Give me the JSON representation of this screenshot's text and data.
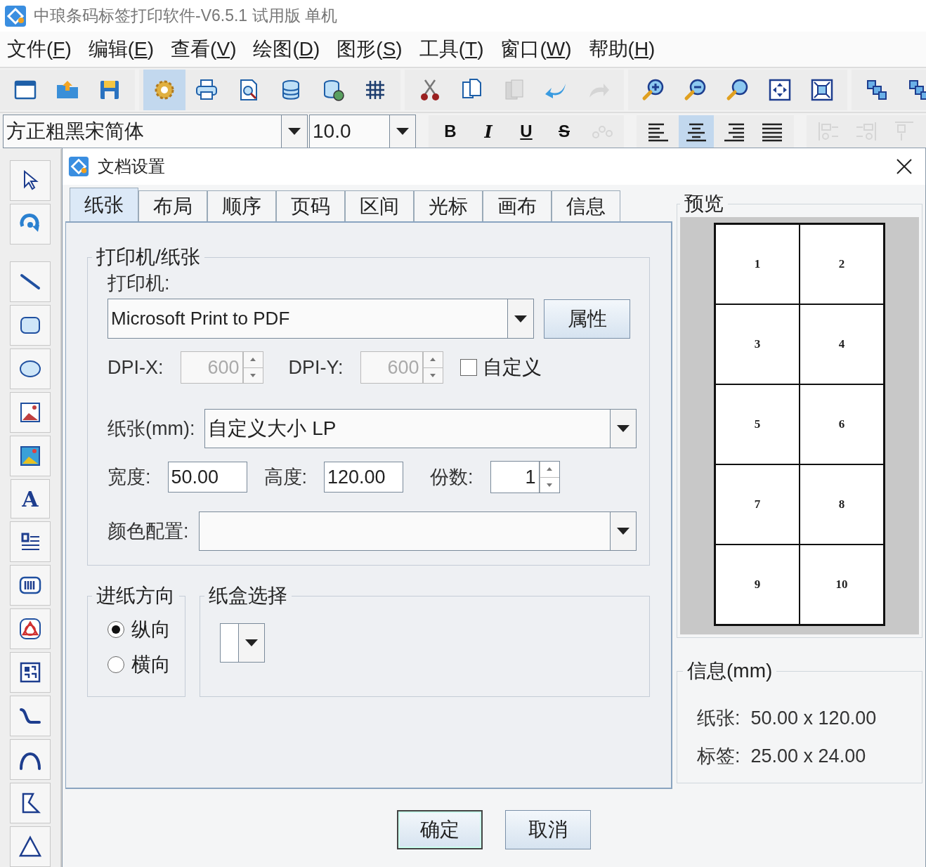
{
  "window": {
    "title": "中琅条码标签打印软件-V6.5.1 试用版 单机"
  },
  "menu": [
    {
      "label": "文件(",
      "key": "F",
      "end": ")"
    },
    {
      "label": "编辑(",
      "key": "E",
      "end": ")"
    },
    {
      "label": "查看(",
      "key": "V",
      "end": ")"
    },
    {
      "label": "绘图(",
      "key": "D",
      "end": ")"
    },
    {
      "label": "图形(",
      "key": "S",
      "end": ")"
    },
    {
      "label": "工具(",
      "key": "T",
      "end": ")"
    },
    {
      "label": "窗口(",
      "key": "W",
      "end": ")"
    },
    {
      "label": "帮助(",
      "key": "H",
      "end": ")"
    }
  ],
  "toolbar": [
    [
      {
        "kind": "window",
        "selected": false,
        "disabled": false
      },
      {
        "kind": "open",
        "selected": false,
        "disabled": false
      },
      {
        "kind": "save",
        "selected": false,
        "disabled": false
      }
    ],
    [
      {
        "kind": "gear",
        "selected": true,
        "disabled": false
      },
      {
        "kind": "print",
        "selected": false,
        "disabled": false
      },
      {
        "kind": "preview",
        "selected": false,
        "disabled": false
      },
      {
        "kind": "database",
        "selected": false,
        "disabled": false
      },
      {
        "kind": "dbsync",
        "selected": false,
        "disabled": false
      },
      {
        "kind": "grid",
        "selected": false,
        "disabled": false
      }
    ],
    [
      {
        "kind": "cut",
        "selected": false,
        "disabled": false
      },
      {
        "kind": "copy",
        "selected": false,
        "disabled": false
      },
      {
        "kind": "paste",
        "selected": false,
        "disabled": true
      },
      {
        "kind": "undo",
        "selected": false,
        "disabled": false
      },
      {
        "kind": "redo",
        "selected": false,
        "disabled": true
      }
    ],
    [
      {
        "kind": "zoomin",
        "selected": false,
        "disabled": false
      },
      {
        "kind": "zoomout",
        "selected": false,
        "disabled": false
      },
      {
        "kind": "zoom",
        "selected": false,
        "disabled": false
      },
      {
        "kind": "fit",
        "selected": false,
        "disabled": false
      },
      {
        "kind": "fitpage",
        "selected": false,
        "disabled": false
      }
    ],
    [
      {
        "kind": "group",
        "selected": false,
        "disabled": false
      },
      {
        "kind": "group",
        "selected": false,
        "disabled": false
      }
    ]
  ],
  "format_bar": {
    "font": "方正粗黑宋简体",
    "size": "10.0",
    "styles": [
      {
        "kind": "bold",
        "label": "B"
      },
      {
        "kind": "italic",
        "label": "I"
      },
      {
        "kind": "underline",
        "label": "U"
      },
      {
        "kind": "strike",
        "label": "S"
      }
    ],
    "tools": [
      [
        {
          "kind": "abc",
          "selected": false,
          "disabled": true
        }
      ],
      [
        {
          "kind": "left",
          "selected": false,
          "disabled": false
        },
        {
          "kind": "center",
          "selected": true,
          "disabled": false
        },
        {
          "kind": "right",
          "selected": false,
          "disabled": false
        },
        {
          "kind": "justify",
          "selected": false,
          "disabled": false
        }
      ],
      [
        {
          "kind": "alignl",
          "selected": false,
          "disabled": true
        },
        {
          "kind": "alignr",
          "selected": false,
          "disabled": true
        },
        {
          "kind": "alignt",
          "selected": false,
          "disabled": true
        }
      ]
    ]
  },
  "palette": [
    {
      "kind": "pointer"
    },
    {
      "kind": "rotate"
    },
    {
      "kind": "line"
    },
    {
      "kind": "rect"
    },
    {
      "kind": "ellipse"
    },
    {
      "kind": "image"
    },
    {
      "kind": "image2"
    },
    {
      "kind": "text",
      "label": "A"
    },
    {
      "kind": "richtext"
    },
    {
      "kind": "barcode"
    },
    {
      "kind": "shape"
    },
    {
      "kind": "qr"
    },
    {
      "kind": "curve"
    },
    {
      "kind": "arc"
    },
    {
      "kind": "polygon"
    },
    {
      "kind": "triangle"
    }
  ],
  "dialog": {
    "title": "文档设置",
    "tabs": [
      {
        "label": "纸张",
        "selected": true
      },
      {
        "label": "布局",
        "selected": false
      },
      {
        "label": "顺序",
        "selected": false
      },
      {
        "label": "页码",
        "selected": false
      },
      {
        "label": "区间",
        "selected": false
      },
      {
        "label": "光标",
        "selected": false
      },
      {
        "label": "画布",
        "selected": false
      },
      {
        "label": "信息",
        "selected": false
      }
    ],
    "printer_group": {
      "legend": "打印机/纸张",
      "printer_label": "打印机:",
      "printer": "Microsoft Print to PDF",
      "properties_button": "属性",
      "dpi_x": {
        "label": "DPI-X:",
        "value": "600",
        "disabled": true
      },
      "dpi_y": {
        "label": "DPI-Y:",
        "value": "600",
        "disabled": true
      },
      "custom": {
        "label": "自定义",
        "checked": false
      },
      "paper_label": "纸张(mm):",
      "paper": "自定义大小 LP",
      "width": {
        "label": "宽度:",
        "value": "50.00"
      },
      "height": {
        "label": "高度:",
        "value": "120.00"
      },
      "copies": {
        "label": "份数:",
        "value": "1"
      },
      "color_label": "颜色配置:"
    },
    "feed_group": {
      "legend": "进纸方向",
      "options": [
        {
          "label": "纵向",
          "selected": true
        },
        {
          "label": "横向",
          "selected": false
        }
      ]
    },
    "tray_group": {
      "legend": "纸盒选择"
    },
    "preview": {
      "legend": "预览",
      "cells": [
        "1",
        "2",
        "3",
        "4",
        "5",
        "6",
        "7",
        "8",
        "9",
        "10"
      ]
    },
    "info": {
      "legend": "信息(mm)",
      "rows": [
        {
          "label": "纸张:",
          "value": "50.00 x 120.00"
        },
        {
          "label": "标签:",
          "value": "25.00 x 24.00"
        }
      ]
    },
    "buttons": [
      {
        "label": "确定",
        "selected": true
      },
      {
        "label": "取消",
        "selected": false
      }
    ]
  }
}
